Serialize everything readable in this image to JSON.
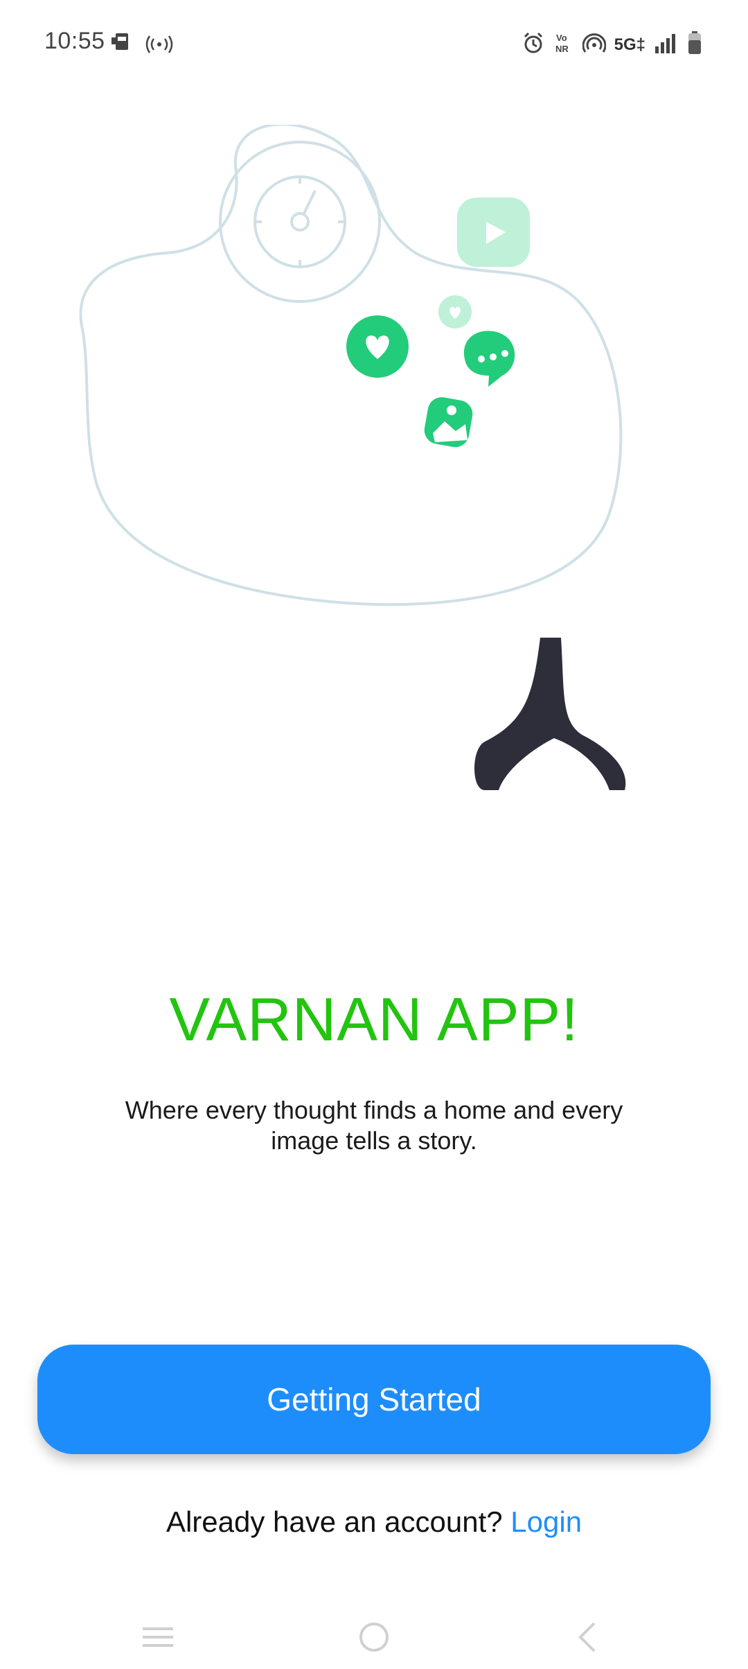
{
  "status_bar": {
    "time": "10:55",
    "left_icons": [
      "nfc-card-icon",
      "hotspot-icon"
    ],
    "right_icons": [
      "alarm-icon",
      "vonr-icon",
      "hotspot-signal-icon",
      "5g-icon",
      "signal-icon",
      "battery-icon"
    ],
    "vonr_label": "Vo\nNR",
    "network_label": "5G‡"
  },
  "illustration": {
    "name": "man-relaxing-with-laptop-illustration",
    "colors": {
      "accent": "#22cc7a",
      "accent_light": "#bff0d8",
      "outline": "#222222",
      "chair": "#d6e6f0",
      "blob": "#cfe0e6",
      "dark": "#2e2e3a"
    }
  },
  "main": {
    "title": "VARNAN APP!",
    "tagline": "Where every thought finds a home and every image tells a story."
  },
  "actions": {
    "primary_button": "Getting Started",
    "login_prompt": "Already have an account?",
    "login_link": "Login"
  },
  "nav_bar": {
    "buttons": [
      "menu-icon",
      "home-icon",
      "back-icon"
    ]
  },
  "colors": {
    "title_green": "#22c40f",
    "button_blue": "#1e8dfc",
    "background": "#ffffff"
  }
}
